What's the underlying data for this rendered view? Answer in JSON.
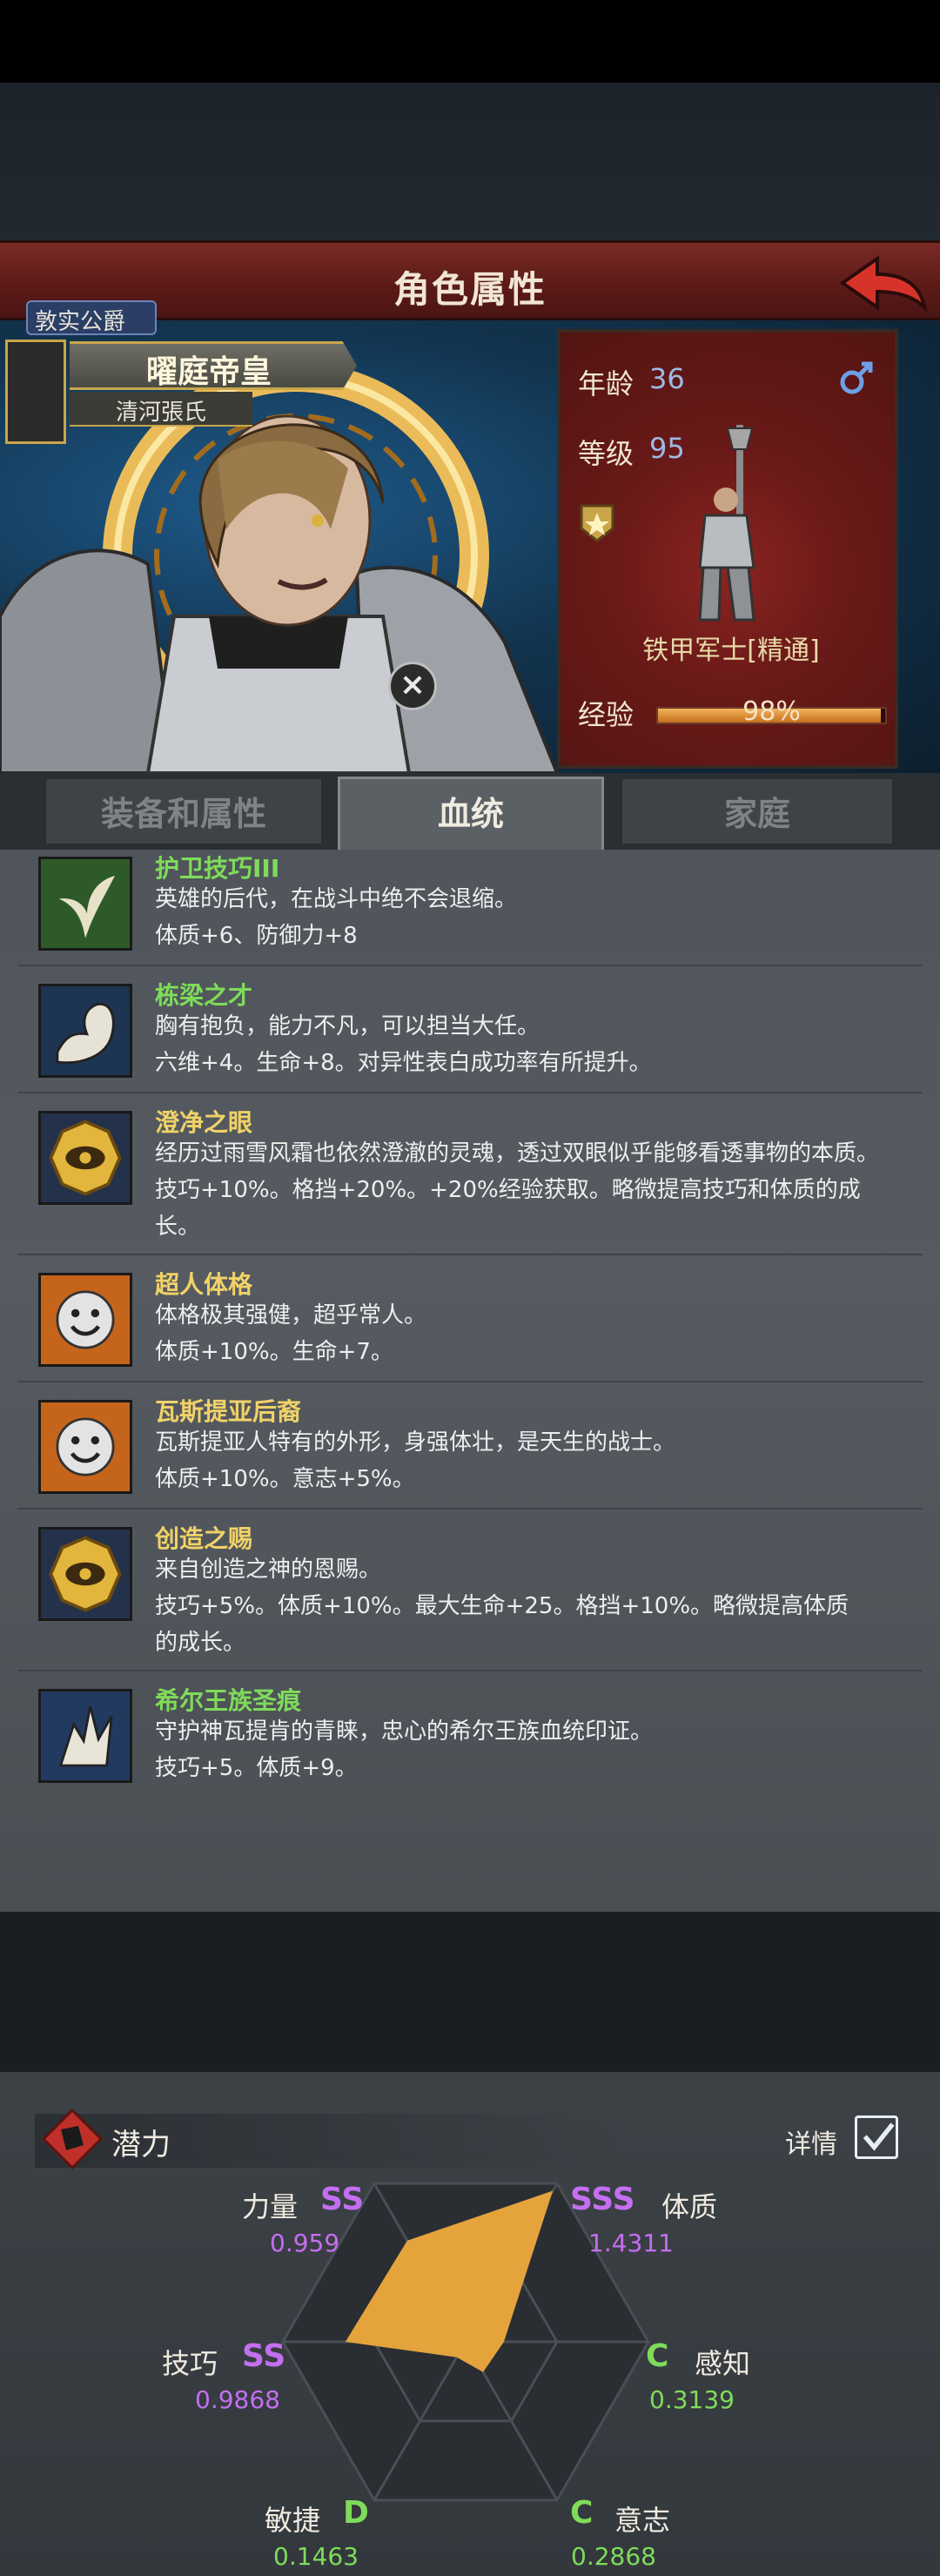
{
  "header": {
    "title": "角色属性",
    "back_icon": "back-arrow-icon"
  },
  "hero": {
    "title_badge": "敦实公爵",
    "name": "曜庭帝皇",
    "clan": "清河張氏"
  },
  "info": {
    "age_label": "年龄",
    "age_value": "36",
    "gender_icon": "male-icon",
    "level_label": "等级",
    "level_value": "95",
    "class_name": "铁甲军士[精通]",
    "exp_label": "经验",
    "exp_percent": 98,
    "exp_text": "98%"
  },
  "tabs": [
    {
      "label": "装备和属性",
      "active": false
    },
    {
      "label": "血统",
      "active": true
    },
    {
      "label": "家庭",
      "active": false
    }
  ],
  "traits": [
    {
      "name": "护卫技巧III",
      "color": "#7fdc5a",
      "icon": "leaf-sprout-icon",
      "desc": [
        "英雄的后代，在战斗中绝不会退缩。",
        "体质+6、防御力+8"
      ]
    },
    {
      "name": "栋梁之才",
      "color": "#7fdc5a",
      "icon": "flexed-arm-icon",
      "desc": [
        "胸有抱负，能力不凡，可以担当大任。",
        "六维+4。生命+8。对异性表白成功率有所提升。"
      ]
    },
    {
      "name": "澄净之眼",
      "color": "#f0d267",
      "icon": "golden-eye-icon",
      "desc": [
        "经历过雨雪风霜也依然澄澈的灵魂，透过双眼似乎能够看透事物的本质。",
        "技巧+10%。格挡+20%。+20%经验获取。略微提高技巧和体质的成",
        "长。"
      ]
    },
    {
      "name": "超人体格",
      "color": "#f0d267",
      "icon": "smiley-face-icon",
      "desc": [
        "体格极其强健，超乎常人。",
        "体质+10%。生命+7。"
      ]
    },
    {
      "name": "瓦斯提亚后裔",
      "color": "#f0d267",
      "icon": "smiley-face-icon",
      "desc": [
        "瓦斯提亚人特有的外形，身强体壮，是天生的战士。",
        "体质+10%。意志+5%。"
      ]
    },
    {
      "name": "创造之赐",
      "color": "#f0d267",
      "icon": "golden-eye-icon",
      "desc": [
        "来自创造之神的恩赐。",
        "技巧+5%。体质+10%。最大生命+25。格挡+10%。略微提高体质",
        "的成长。"
      ]
    },
    {
      "name": "希尔王族圣痕",
      "color": "#7fdc5a",
      "icon": "wolf-emblem-icon",
      "desc": [
        "守护神瓦提肯的青睐，忠心的希尔王族血统印证。",
        "技巧+5。体质+9。"
      ]
    }
  ],
  "potential": {
    "title": "潜力",
    "detail_label": "详情",
    "stats": [
      {
        "name": "力量",
        "grade": "SS",
        "value": "0.959",
        "num": 0.959
      },
      {
        "name": "体质",
        "grade": "SSS",
        "value": "1.4311",
        "num": 1.4311
      },
      {
        "name": "感知",
        "grade": "C",
        "value": "0.3139",
        "num": 0.3139
      },
      {
        "name": "意志",
        "grade": "C",
        "value": "0.2868",
        "num": 0.2868
      },
      {
        "name": "敏捷",
        "grade": "D",
        "value": "0.1463",
        "num": 0.1463
      },
      {
        "name": "技巧",
        "grade": "SS",
        "value": "0.9868",
        "num": 0.9868
      }
    ],
    "colors": {
      "grade_purple": "#c36ff0",
      "grade_green": "#7fdc5a",
      "fill": "#e5a33c"
    }
  }
}
